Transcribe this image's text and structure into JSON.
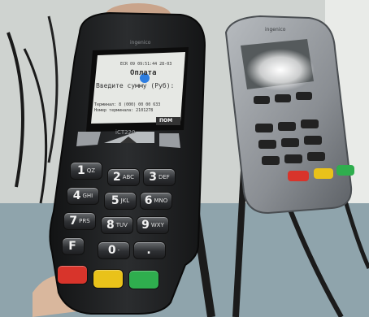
{
  "main_terminal": {
    "brand_text": "ingenico",
    "screen": {
      "status_line": "ECR 09  09:51:44 28-03",
      "title": "Оплата",
      "prompt": "Введите сумму (Руб):",
      "terminal_line": "Терминал: 8 (000) 00 00 633",
      "model_line": "Номер терминала: 2101278",
      "soft_key_label": "ПОМ"
    },
    "model_badge": "iCT220",
    "keys": [
      {
        "main": "1",
        "sub": "QZ"
      },
      {
        "main": "2",
        "sub": "ABC"
      },
      {
        "main": "3",
        "sub": "DEF"
      },
      {
        "main": "4",
        "sub": "GHI"
      },
      {
        "main": "5",
        "sub": "JKL"
      },
      {
        "main": "6",
        "sub": "MNO"
      },
      {
        "main": "7",
        "sub": "PRS"
      },
      {
        "main": "8",
        "sub": "TUV"
      },
      {
        "main": "9",
        "sub": "WXY"
      },
      {
        "main": "F",
        "sub": ""
      },
      {
        "main": "0",
        "sub": "-"
      },
      {
        "main": ".",
        "sub": ""
      }
    ],
    "function_keys": {
      "cancel_color": "#d8342b",
      "clear_color": "#e9c21a",
      "enter_color": "#2fae4e"
    }
  },
  "pin_pad": {
    "brand_text": "ingenico"
  },
  "colors": {
    "device_body": "#232526",
    "pinpad_body": "#8d9196",
    "wall": "#d6d8d5"
  }
}
